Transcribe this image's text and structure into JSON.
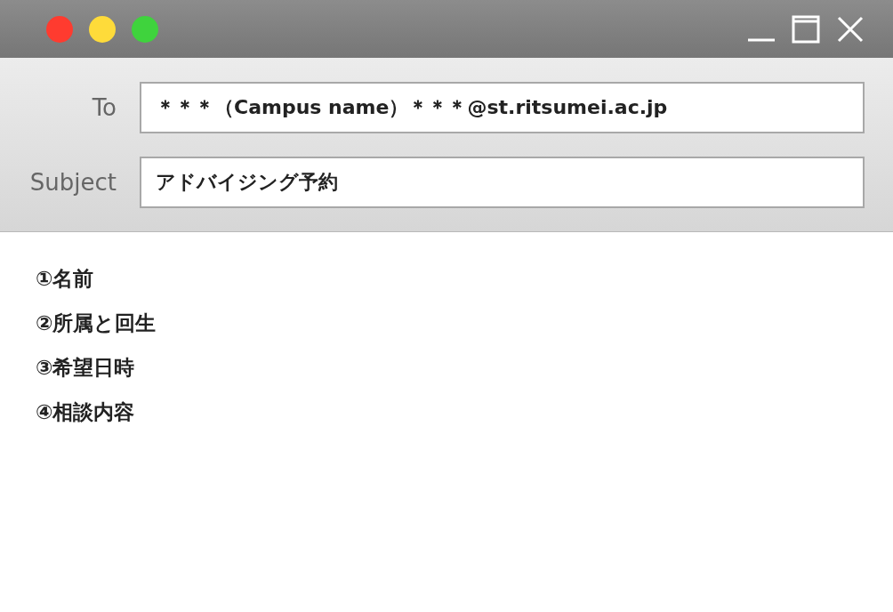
{
  "fields": [
    {
      "label": "To",
      "value": "＊＊＊（Campus name）＊＊＊@st.ritsumei.ac.jp"
    },
    {
      "label": "Subject",
      "value": "アドバイジング予約"
    }
  ],
  "body": {
    "lines": [
      "①名前",
      "②所属と回生",
      "③希望日時",
      "④相談内容"
    ]
  }
}
